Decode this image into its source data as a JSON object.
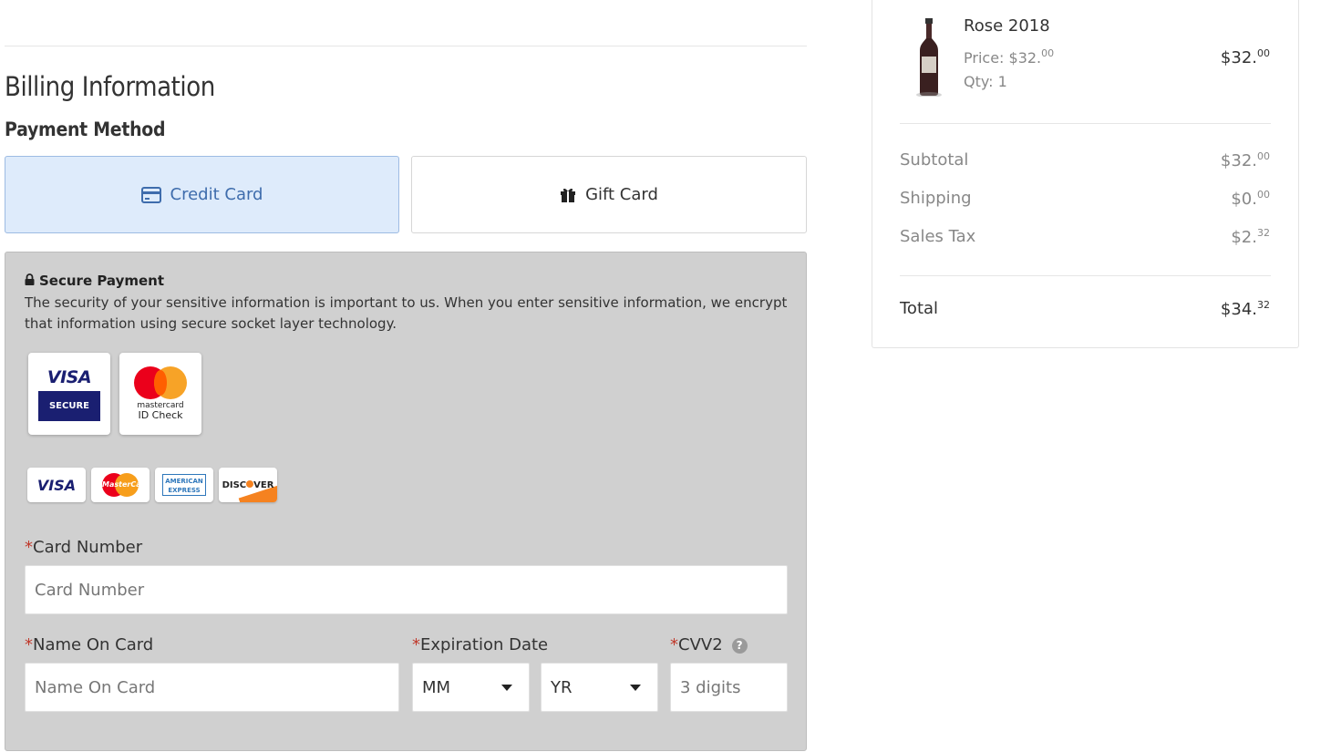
{
  "billing": {
    "title": "Billing Information",
    "payment_method_label": "Payment Method",
    "tabs": [
      {
        "label": "Credit Card",
        "icon": "credit-card-icon",
        "active": true
      },
      {
        "label": "Gift Card",
        "icon": "gift-icon",
        "active": false
      }
    ]
  },
  "secure_payment": {
    "heading": "Secure Payment",
    "text": "The security of your sensitive information is important to us. When you enter sensitive information, we encrypt that information using secure socket layer technology.",
    "badges": {
      "visa_word": "VISA",
      "visa_secure": "SECURE",
      "mc_line1": "mastercard",
      "mc_line2": "ID Check"
    },
    "logos": {
      "visa": "VISA",
      "mastercard": "MasterCard",
      "amex_line1": "AMERICAN",
      "amex_line2": "EXPRESS",
      "discover_pre": "DISC",
      "discover_post": "VER"
    }
  },
  "form": {
    "required_mark": "*",
    "card_number": {
      "label": "Card Number",
      "placeholder": "Card Number"
    },
    "name_on_card": {
      "label": "Name On Card",
      "placeholder": "Name On Card"
    },
    "expiration": {
      "label": "Expiration Date",
      "month_value": "MM",
      "year_value": "YR"
    },
    "cvv": {
      "label": "CVV2",
      "placeholder": "3 digits",
      "help": "?"
    }
  },
  "order_summary": {
    "item": {
      "name": "Rose 2018",
      "price_label": "Price: $32.",
      "price_cents": "00",
      "qty_label": "Qty: 1",
      "total_dollars": "$32.",
      "total_cents": "00"
    },
    "rows": [
      {
        "label": "Subtotal",
        "dollars": "$32.",
        "cents": "00"
      },
      {
        "label": "Shipping",
        "dollars": "$0.",
        "cents": "00"
      },
      {
        "label": "Sales Tax",
        "dollars": "$2.",
        "cents": "32"
      }
    ],
    "total": {
      "label": "Total",
      "dollars": "$34.",
      "cents": "32"
    }
  },
  "colors": {
    "active_tab_bg": "#deebfb",
    "active_tab_text": "#3e6cac",
    "panel_bg": "#d0d0d0",
    "required": "#c0392b"
  }
}
